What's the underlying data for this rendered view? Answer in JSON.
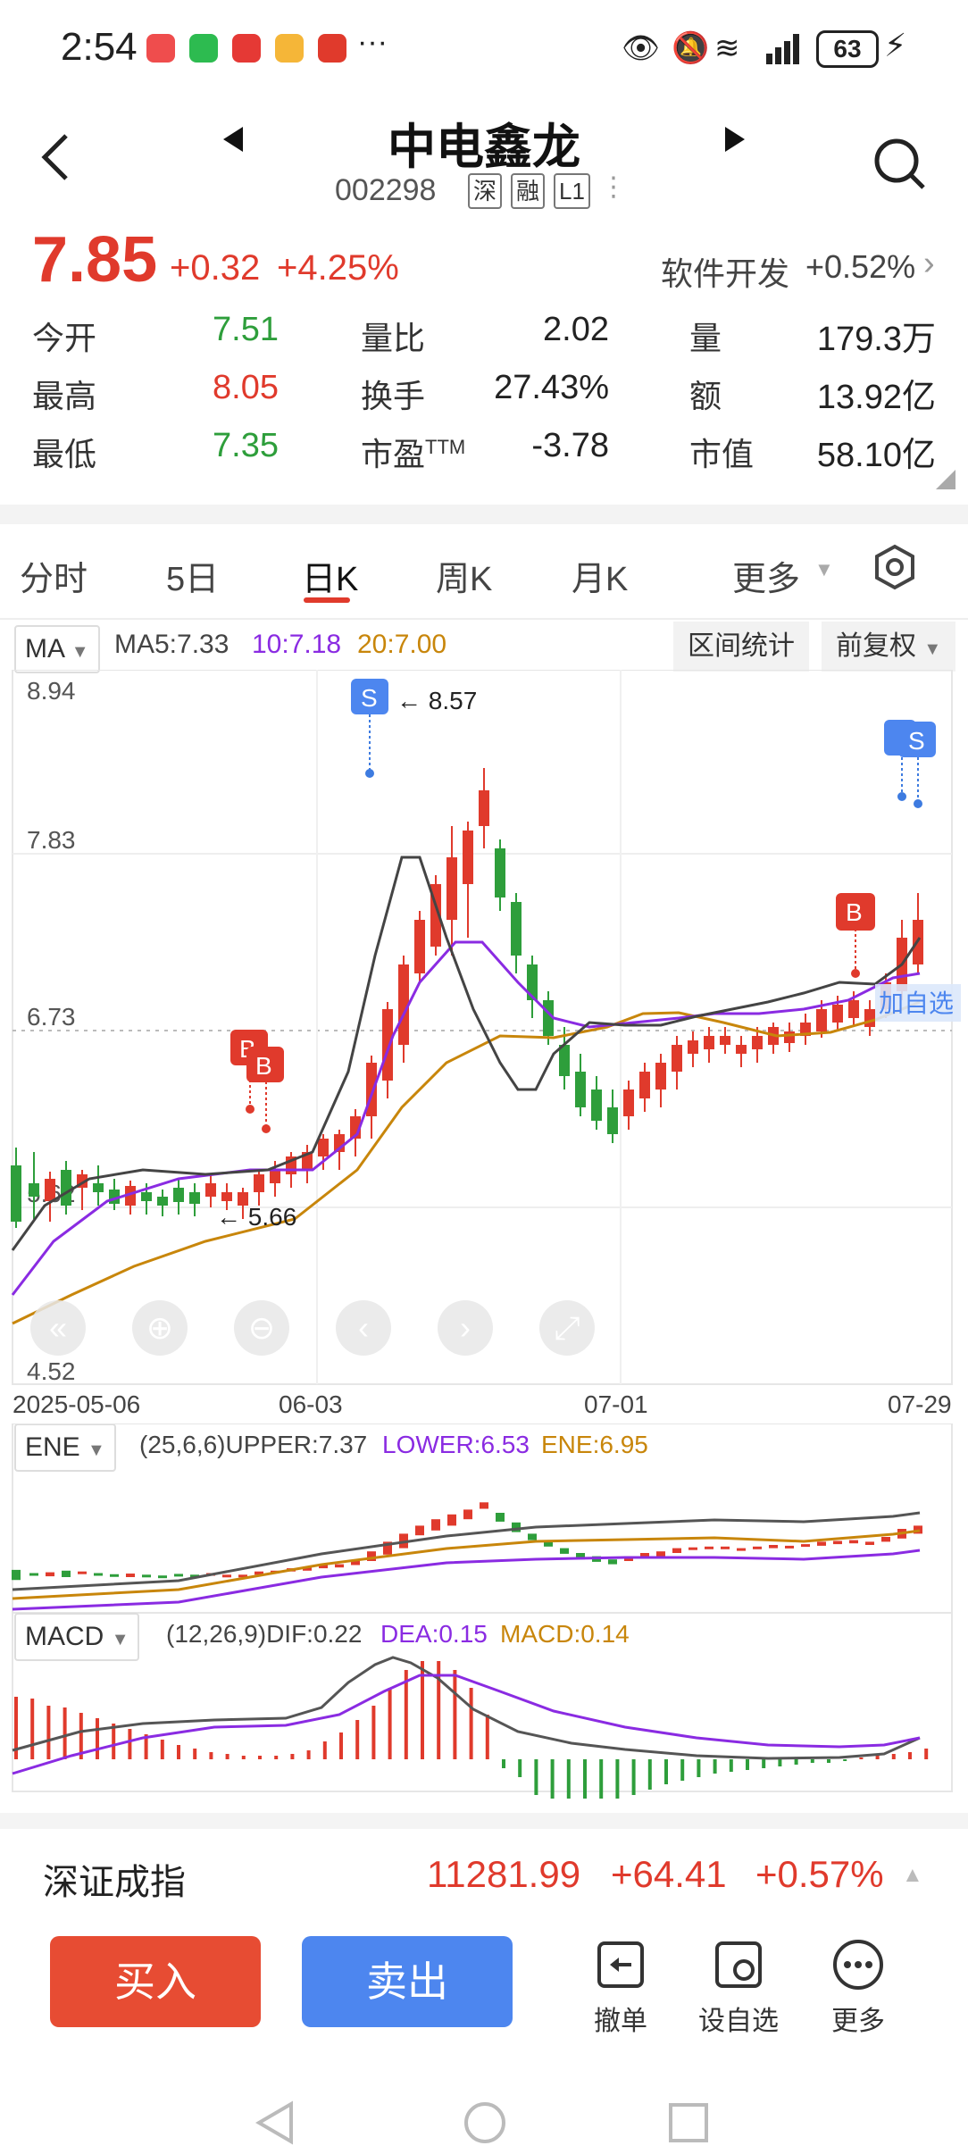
{
  "status_bar": {
    "time": "2:54",
    "battery": "63",
    "extra": "···",
    "signal_label": "6"
  },
  "header": {
    "title": "中电鑫龙",
    "code": "002298",
    "tags": [
      "深",
      "融",
      "L1"
    ]
  },
  "quote": {
    "price": "7.85",
    "change": "+0.32",
    "change_pct": "+4.25%",
    "sector_name": "软件开发",
    "sector_pct": "+0.52%",
    "rows": [
      [
        {
          "label": "今开",
          "value": "7.51",
          "color": "green"
        },
        {
          "label": "量比",
          "value": "2.02"
        },
        {
          "label": "量",
          "value": "179.3万"
        }
      ],
      [
        {
          "label": "最高",
          "value": "8.05",
          "color": "red"
        },
        {
          "label": "换手",
          "value": "27.43%"
        },
        {
          "label": "额",
          "value": "13.92亿"
        }
      ],
      [
        {
          "label": "最低",
          "value": "7.35",
          "color": "green"
        },
        {
          "label": "市盈",
          "sup": "TTM",
          "value": "-3.78"
        },
        {
          "label": "市值",
          "value": "58.10亿"
        }
      ]
    ]
  },
  "tabs": [
    "分时",
    "5日",
    "日K",
    "周K",
    "月K",
    "更多"
  ],
  "active_tab": "日K",
  "toolbar": {
    "ma_select": "MA",
    "ma5": "MA5:7.33",
    "ma10": "10:7.18",
    "ma20": "20:7.00",
    "range_stats": "区间统计",
    "adjust": "前复权"
  },
  "main_chart": {
    "y_labels": [
      "8.94",
      "7.83",
      "6.73",
      "5.62",
      "4.52"
    ],
    "x_labels": [
      "2025-05-06",
      "06-03",
      "07-01",
      "07-29"
    ],
    "annotation_high": "← 8.57",
    "annotation_low": "← 5.66",
    "add_watchlist": "加自选",
    "markers": {
      "buy": "B",
      "sell": "S"
    }
  },
  "ene": {
    "select": "ENE",
    "params": "(25,6,6)UPPER:7.37",
    "lower": "LOWER:6.53",
    "ene": "ENE:6.95"
  },
  "macd": {
    "select": "MACD",
    "params": "(12,26,9)DIF:0.22",
    "dea": "DEA:0.15",
    "macd": "MACD:0.14"
  },
  "index_bar": {
    "name": "深证成指",
    "value": "11281.99",
    "change": "+64.41",
    "pct": "+0.57%"
  },
  "bottom": {
    "buy": "买入",
    "sell": "卖出",
    "cancel": "撤单",
    "set_watch": "设自选",
    "more": "更多"
  },
  "colors": {
    "up": "#e03a2c",
    "down": "#2e9e3b",
    "ma5": "#333333",
    "ma10": "#8a2be2",
    "ma20": "#c8860b",
    "buy_btn": "#e74c33",
    "sell_btn": "#4d86ef"
  }
}
